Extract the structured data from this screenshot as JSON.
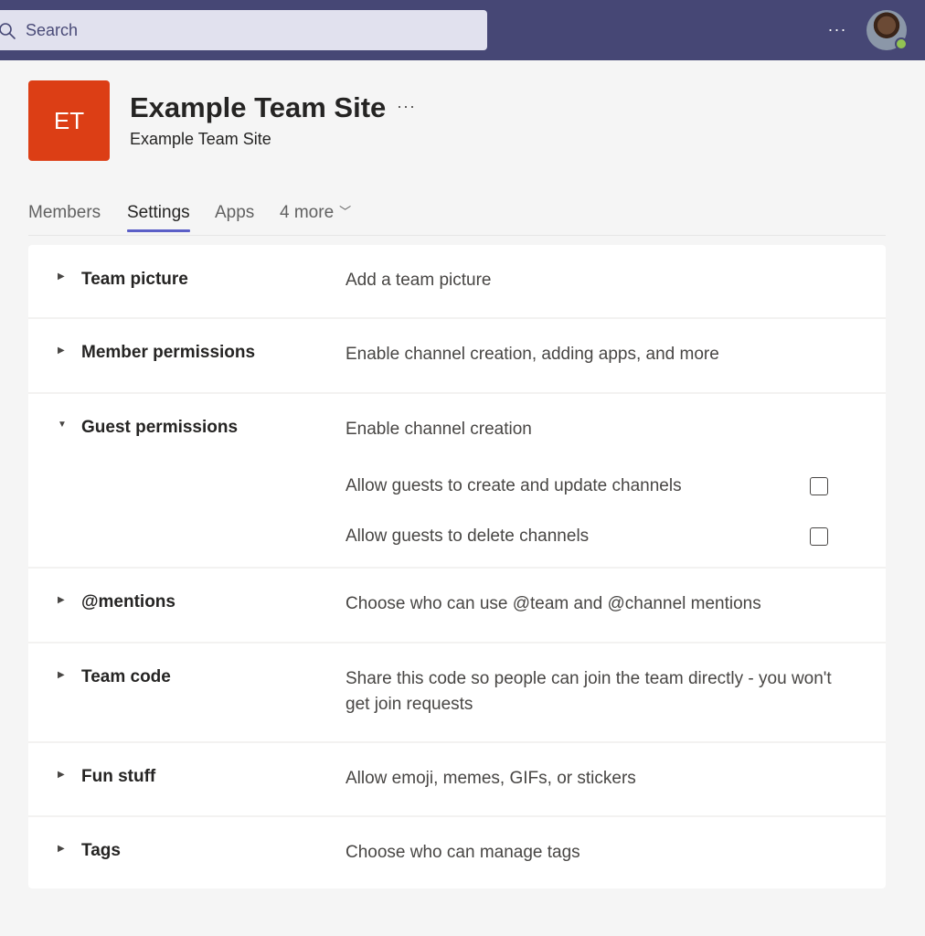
{
  "search": {
    "placeholder": "Search"
  },
  "topbar": {
    "more_label": "···"
  },
  "team": {
    "initials": "ET",
    "name": "Example Team Site",
    "subtitle": "Example Team Site",
    "more_label": "···",
    "tile_color": "#dc3e15"
  },
  "tabs": [
    {
      "label": "Members"
    },
    {
      "label": "Settings",
      "active": true
    },
    {
      "label": "Apps"
    },
    {
      "label": "4 more"
    }
  ],
  "settings": [
    {
      "title": "Team picture",
      "description": "Add a team picture",
      "expanded": false
    },
    {
      "title": "Member permissions",
      "description": "Enable channel creation, adding apps, and more",
      "expanded": false
    },
    {
      "title": "Guest permissions",
      "description": "Enable channel creation",
      "expanded": true,
      "options": [
        {
          "label": "Allow guests to create and update channels",
          "checked": false
        },
        {
          "label": "Allow guests to delete channels",
          "checked": false
        }
      ]
    },
    {
      "title": "@mentions",
      "description": "Choose who can use @team and @channel mentions",
      "expanded": false
    },
    {
      "title": "Team code",
      "description": "Share this code so people can join the team directly - you won't get join requests",
      "expanded": false
    },
    {
      "title": "Fun stuff",
      "description": "Allow emoji, memes, GIFs, or stickers",
      "expanded": false
    },
    {
      "title": "Tags",
      "description": "Choose who can manage tags",
      "expanded": false
    }
  ],
  "colors": {
    "topbar": "#464775",
    "accent": "#5b5fc7",
    "presence": "#92c353"
  }
}
